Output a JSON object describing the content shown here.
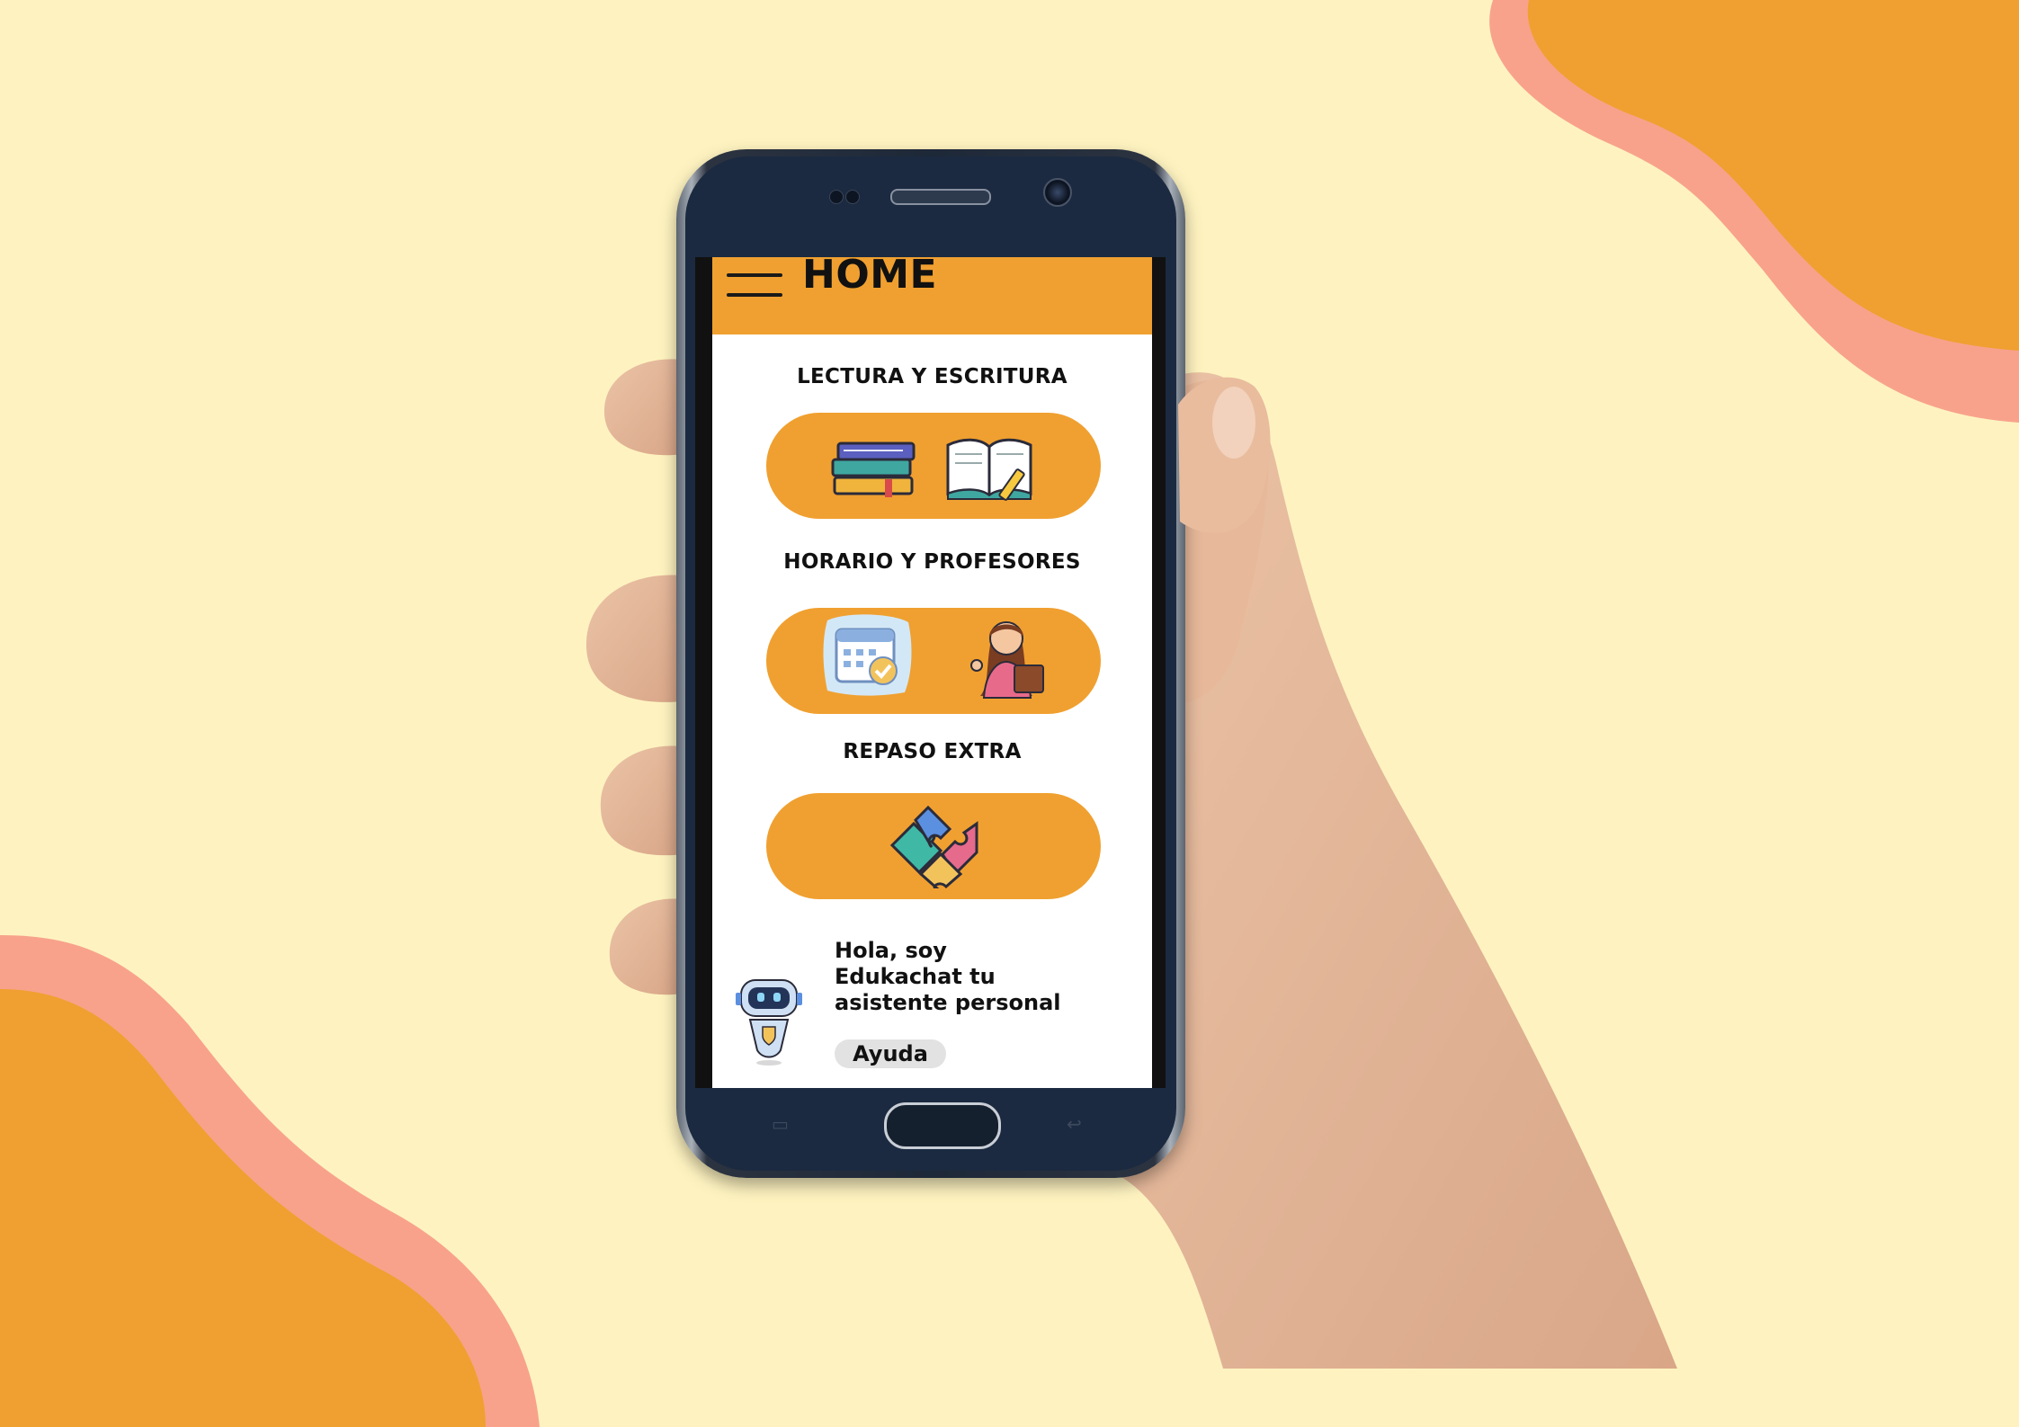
{
  "colors": {
    "background": "#FEF3C0",
    "accent_orange": "#F0A030",
    "accent_pink": "#F8A28C",
    "phone_body": "#1B2A40"
  },
  "app": {
    "header": {
      "title": "HOME",
      "menu_icon": "hamburger-menu-icon"
    },
    "sections": [
      {
        "label": "LECTURA Y ESCRITURA",
        "icons": [
          "books-stack-icon",
          "open-book-pencil-icon"
        ]
      },
      {
        "label": "HORARIO Y PROFESORES",
        "icons": [
          "calendar-check-icon",
          "teacher-icon"
        ]
      },
      {
        "label": "REPASO EXTRA",
        "icons": [
          "puzzle-pieces-icon"
        ]
      }
    ],
    "assistant": {
      "icon": "robot-icon",
      "message_lines": [
        "Hola, soy",
        "Edukachat tu",
        "asistente personal"
      ],
      "help_label": "Ayuda"
    }
  }
}
